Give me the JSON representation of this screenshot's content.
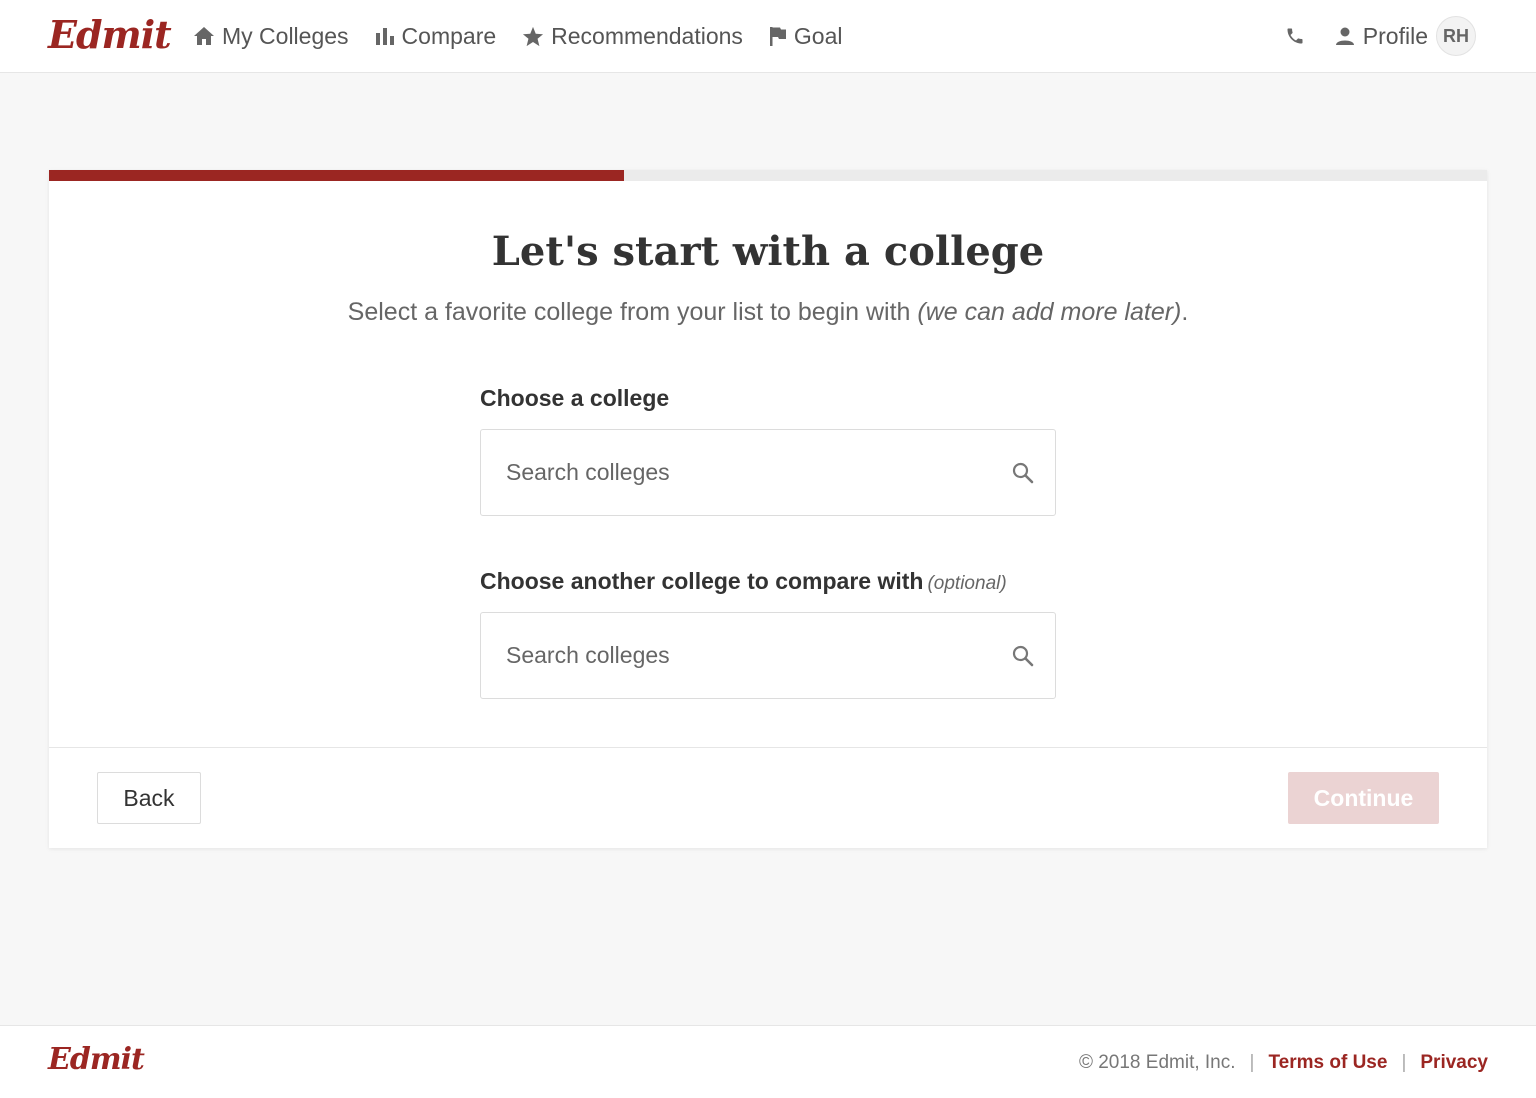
{
  "brand": {
    "name": "Edmit",
    "accent": "#9b2622"
  },
  "nav": {
    "items": [
      {
        "label": "My Colleges",
        "icon": "home-icon"
      },
      {
        "label": "Compare",
        "icon": "bar-chart-icon"
      },
      {
        "label": "Recommendations",
        "icon": "star-icon"
      },
      {
        "label": "Goal",
        "icon": "flag-icon"
      }
    ],
    "profile_label": "Profile",
    "avatar_initials": "RH"
  },
  "wizard": {
    "progress": 0.4,
    "title": "Let's start with a college",
    "subtitle_main": "Select a favorite college from your list to begin with ",
    "subtitle_italic": "(we can add more later)",
    "subtitle_end": ".",
    "field1": {
      "label": "Choose a college",
      "placeholder": "Search colleges"
    },
    "field2": {
      "label": "Choose another college to compare with",
      "optional": "(optional)",
      "placeholder": "Search colleges"
    },
    "back_label": "Back",
    "continue_label": "Continue"
  },
  "footer": {
    "copyright": "© 2018 Edmit, Inc.",
    "sep": "|",
    "terms": "Terms of Use",
    "privacy": "Privacy"
  }
}
